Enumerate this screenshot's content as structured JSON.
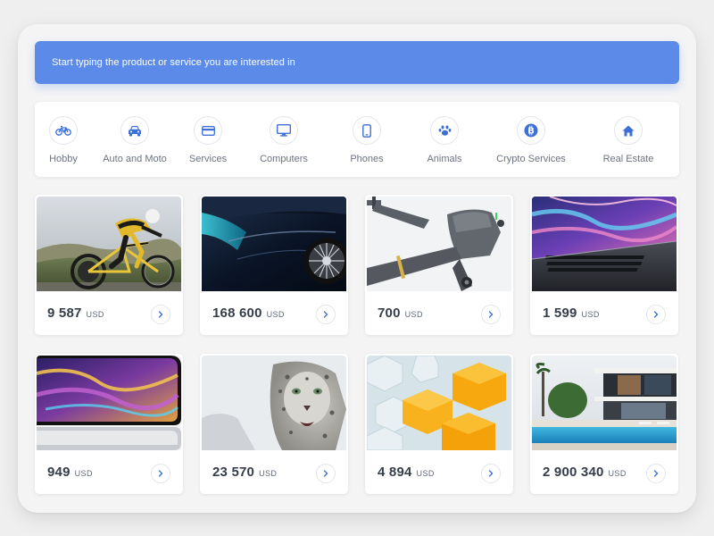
{
  "search": {
    "placeholder": "Start typing the product or service you are interested in"
  },
  "categories": [
    {
      "label": "Hobby",
      "icon": "bicycle-icon"
    },
    {
      "label": "Auto and Moto",
      "icon": "car-icon"
    },
    {
      "label": "Services",
      "icon": "credit-card-icon"
    },
    {
      "label": "Computers",
      "icon": "monitor-icon"
    },
    {
      "label": "Phones",
      "icon": "smartphone-icon"
    },
    {
      "label": "Animals",
      "icon": "paw-icon"
    },
    {
      "label": "Crypto Services",
      "icon": "bitcoin-icon"
    },
    {
      "label": "Real Estate",
      "icon": "home-icon"
    }
  ],
  "products": [
    {
      "price": "9 587",
      "currency": "USD",
      "image": "cyclist"
    },
    {
      "price": "168 600",
      "currency": "USD",
      "image": "car"
    },
    {
      "price": "700",
      "currency": "USD",
      "image": "drone"
    },
    {
      "price": "1 599",
      "currency": "USD",
      "image": "laptop"
    },
    {
      "price": "949",
      "currency": "USD",
      "image": "phone"
    },
    {
      "price": "23 570",
      "currency": "USD",
      "image": "snow-leopard"
    },
    {
      "price": "4 894",
      "currency": "USD",
      "image": "hexagons"
    },
    {
      "price": "2 900 340",
      "currency": "USD",
      "image": "villa"
    }
  ],
  "colors": {
    "accent": "#5b8ae9",
    "icon": "#3d6fd8",
    "price_text": "#363d4a",
    "label_text": "#6c7280"
  }
}
